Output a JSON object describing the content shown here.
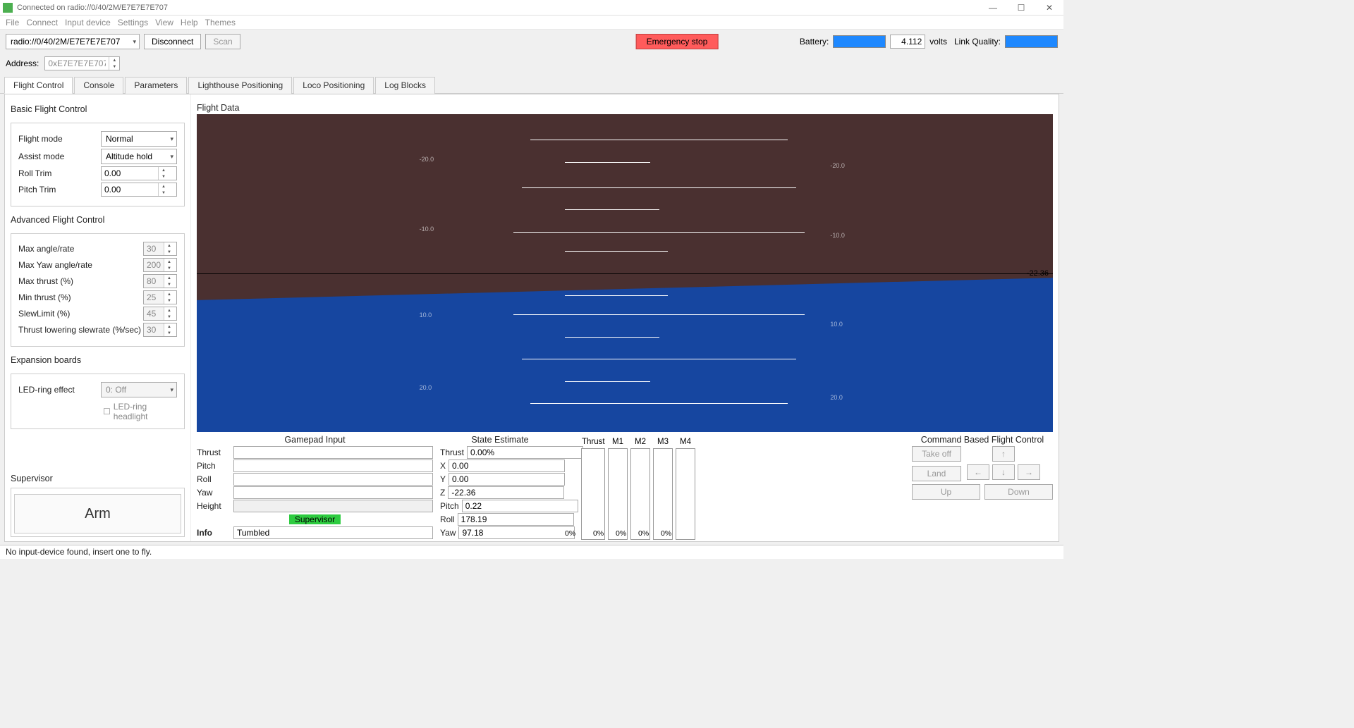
{
  "window": {
    "title": "Connected on radio://0/40/2M/E7E7E7E707"
  },
  "menu": [
    "File",
    "Connect",
    "Input device",
    "Settings",
    "View",
    "Help",
    "Themes"
  ],
  "toolbar": {
    "radio_uri": "radio://0/40/2M/E7E7E7E707",
    "disconnect": "Disconnect",
    "scan": "Scan",
    "emergency": "Emergency stop",
    "battery_label": "Battery:",
    "volts_value": "4.112",
    "volts_label": "volts",
    "link_label": "Link Quality:"
  },
  "address": {
    "label": "Address:",
    "value": "0xE7E7E7E707"
  },
  "tabs": [
    "Flight Control",
    "Console",
    "Parameters",
    "Lighthouse Positioning",
    "Loco Positioning",
    "Log Blocks"
  ],
  "basic": {
    "title": "Basic Flight Control",
    "flight_mode_label": "Flight mode",
    "flight_mode_value": "Normal",
    "assist_mode_label": "Assist mode",
    "assist_mode_value": "Altitude hold",
    "roll_trim_label": "Roll Trim",
    "roll_trim_value": "0.00",
    "pitch_trim_label": "Pitch Trim",
    "pitch_trim_value": "0.00"
  },
  "advanced": {
    "title": "Advanced Flight Control",
    "max_angle_label": "Max angle/rate",
    "max_angle_value": "30",
    "max_yaw_label": "Max Yaw angle/rate",
    "max_yaw_value": "200",
    "max_thrust_label": "Max thrust (%)",
    "max_thrust_value": "80",
    "min_thrust_label": "Min thrust (%)",
    "min_thrust_value": "25",
    "slew_limit_label": "SlewLimit (%)",
    "slew_limit_value": "45",
    "thrust_slew_label": "Thrust lowering slewrate (%/sec)",
    "thrust_slew_value": "30"
  },
  "expansion": {
    "title": "Expansion boards",
    "led_effect_label": "LED-ring effect",
    "led_effect_value": "0: Off",
    "led_headlight_label": "LED-ring headlight"
  },
  "supervisor": {
    "title": "Supervisor",
    "arm_label": "Arm"
  },
  "flightdata": {
    "title": "Flight Data",
    "z_readout": "-22.36"
  },
  "gamepad": {
    "title": "Gamepad Input",
    "thrust_label": "Thrust",
    "pitch_label": "Pitch",
    "roll_label": "Roll",
    "yaw_label": "Yaw",
    "height_label": "Height",
    "supervisor_badge": "Supervisor",
    "info_label": "Info",
    "info_value": "Tumbled"
  },
  "state": {
    "title": "State Estimate",
    "thrust_label": "Thrust",
    "thrust_value": "0.00%",
    "x_label": "X",
    "x_value": "0.00",
    "y_label": "Y",
    "y_value": "0.00",
    "z_label": "Z",
    "z_value": "-22.36",
    "pitch_label": "Pitch",
    "pitch_value": "0.22",
    "roll_label": "Roll",
    "roll_value": "178.19",
    "yaw_label": "Yaw",
    "yaw_value": "97.18"
  },
  "motors": {
    "thrust_label": "Thrust",
    "thrust_val": "0%",
    "m1": "M1",
    "m1_val": "0%",
    "m2": "M2",
    "m2_val": "0%",
    "m3": "M3",
    "m3_val": "0%",
    "m4": "M4",
    "m4_val": "0%"
  },
  "command": {
    "title": "Command Based Flight Control",
    "takeoff": "Take off",
    "land": "Land",
    "up": "Up",
    "down": "Down"
  },
  "statusbar": "No input-device found, insert one to fly."
}
